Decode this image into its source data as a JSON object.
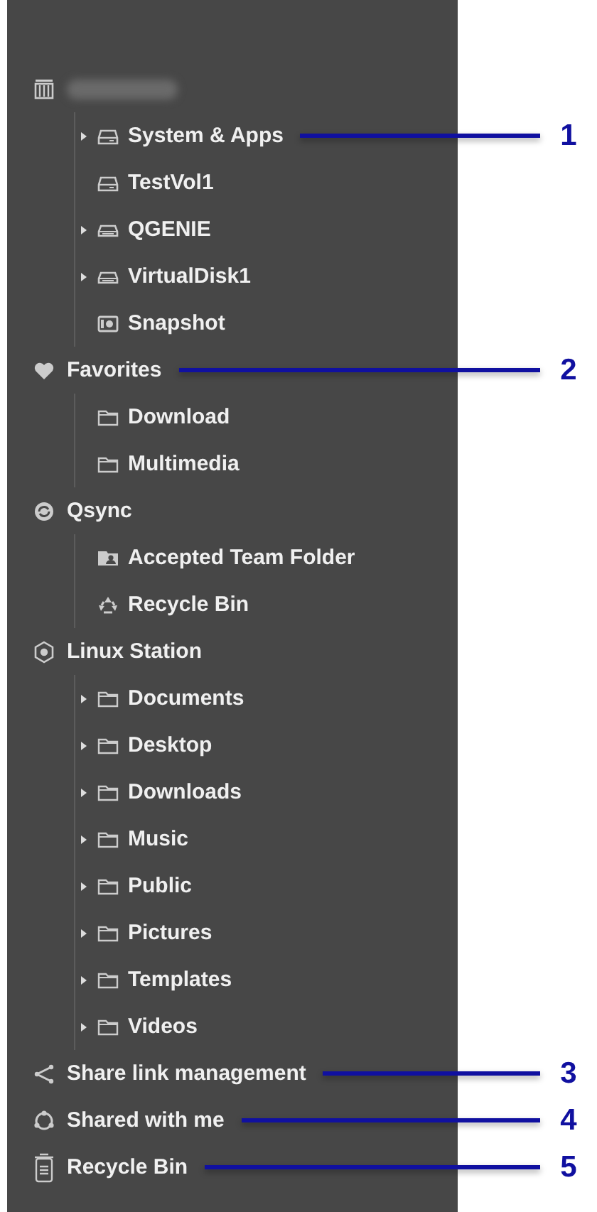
{
  "tree": [
    {
      "kind": "nas",
      "redacted": true,
      "children": [
        {
          "kind": "volume",
          "label": "System & Apps",
          "expandable": true,
          "callout": "1"
        },
        {
          "kind": "volume",
          "label": "TestVol1",
          "expandable": false
        },
        {
          "kind": "disk",
          "label": "QGENIE",
          "expandable": true
        },
        {
          "kind": "disk",
          "label": "VirtualDisk1",
          "expandable": true
        },
        {
          "kind": "snapshot",
          "label": "Snapshot",
          "expandable": false
        }
      ]
    },
    {
      "kind": "favorites",
      "label": "Favorites",
      "callout": "2",
      "children": [
        {
          "kind": "folder",
          "label": "Download",
          "expandable": false
        },
        {
          "kind": "folder",
          "label": "Multimedia",
          "expandable": false
        }
      ]
    },
    {
      "kind": "qsync",
      "label": "Qsync",
      "children": [
        {
          "kind": "team",
          "label": "Accepted Team Folder",
          "expandable": false
        },
        {
          "kind": "recycle",
          "label": "Recycle Bin",
          "expandable": false
        }
      ]
    },
    {
      "kind": "linux",
      "label": "Linux Station",
      "children": [
        {
          "kind": "folder",
          "label": "Documents",
          "expandable": true
        },
        {
          "kind": "folder",
          "label": "Desktop",
          "expandable": true
        },
        {
          "kind": "folder",
          "label": "Downloads",
          "expandable": true
        },
        {
          "kind": "folder",
          "label": "Music",
          "expandable": true
        },
        {
          "kind": "folder",
          "label": "Public",
          "expandable": true
        },
        {
          "kind": "folder",
          "label": "Pictures",
          "expandable": true
        },
        {
          "kind": "folder",
          "label": "Templates",
          "expandable": true
        },
        {
          "kind": "folder",
          "label": "Videos",
          "expandable": true
        }
      ]
    },
    {
      "kind": "share",
      "label": "Share link management",
      "callout": "3"
    },
    {
      "kind": "shared",
      "label": "Shared with me",
      "callout": "4"
    },
    {
      "kind": "trash",
      "label": "Recycle Bin",
      "callout": "5"
    }
  ]
}
